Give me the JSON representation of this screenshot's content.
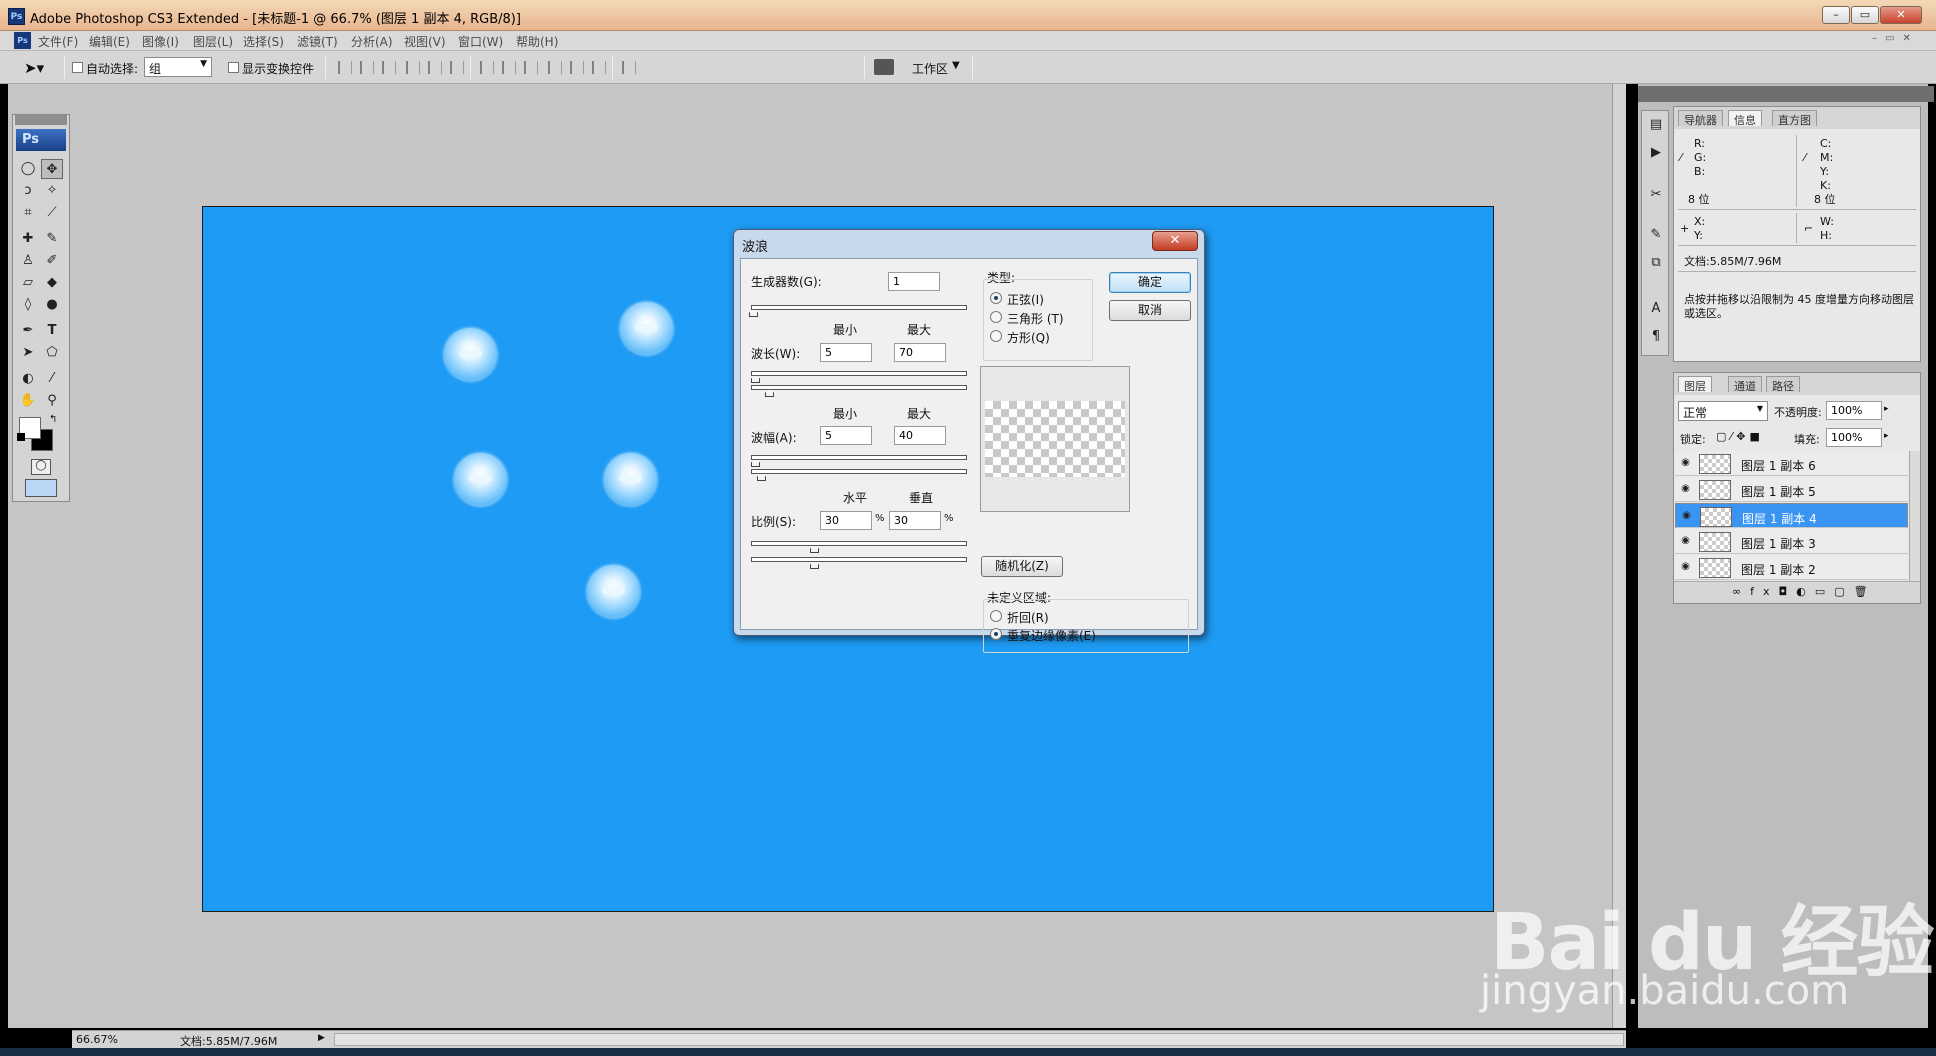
{
  "window": {
    "title": "Adobe Photoshop CS3 Extended - [未标题-1 @ 66.7% (图层 1 副本 4, RGB/8)]",
    "ps_logo": "Ps"
  },
  "menu": [
    "文件(F)",
    "编辑(E)",
    "图像(I)",
    "图层(L)",
    "选择(S)",
    "滤镜(T)",
    "分析(A)",
    "视图(V)",
    "窗口(W)",
    "帮助(H)"
  ],
  "options": {
    "auto_select_label": "自动选择:",
    "auto_select_value": "组",
    "show_transform_label": "显示变换控件",
    "workspace_label": "工作区"
  },
  "toolbox": {
    "logo": "Ps"
  },
  "dialog": {
    "title": "波浪",
    "generators_label": "生成器数(G):",
    "generators_value": "1",
    "min_label": "最小",
    "max_label": "最大",
    "wavelength_label": "波长(W):",
    "wavelength_min": "5",
    "wavelength_max": "70",
    "amplitude_label": "波幅(A):",
    "amplitude_min": "5",
    "amplitude_max": "40",
    "horizontal_label": "水平",
    "vertical_label": "垂直",
    "scale_label": "比例(S):",
    "scale_h": "30",
    "scale_v": "30",
    "percent": "%",
    "type_label": "类型:",
    "types": [
      "正弦(I)",
      "三角形 (T)",
      "方形(Q)"
    ],
    "ok": "确定",
    "cancel": "取消",
    "randomize": "随机化(Z)",
    "undefined_label": "未定义区域:",
    "undefined_opts": [
      "折回(R)",
      "重复边缘像素(E)"
    ]
  },
  "info_panel": {
    "tabs": [
      "导航器",
      "信息",
      "直方图"
    ],
    "r": "R:",
    "g": "G:",
    "b": "B:",
    "c": "C:",
    "m": "M:",
    "y": "Y:",
    "k": "K:",
    "bits_left": "8 位",
    "bits_right": "8 位",
    "x": "X:",
    "y2": "Y:",
    "w": "W:",
    "h": "H:",
    "doc": "文档:5.85M/7.96M",
    "hint": "点按并拖移以沿限制为 45 度增量方向移动图层或选区。"
  },
  "layers_panel": {
    "tabs": [
      "图层",
      "通道",
      "路径"
    ],
    "blend": "正常",
    "opacity_label": "不透明度:",
    "opacity": "100%",
    "lock_label": "锁定:",
    "fill_label": "填充:",
    "fill": "100%",
    "layers": [
      "图层 1 副本 6",
      "图层 1 副本 5",
      "图层 1 副本 4",
      "图层 1 副本 3",
      "图层 1 副本 2"
    ]
  },
  "status": {
    "zoom": "66.67%",
    "doc": "文档:5.85M/7.96M"
  },
  "watermark": {
    "brand": "Bai du 经验",
    "url": "jingyan.baidu.com"
  },
  "colors": {
    "canvas": "#1e9bf4",
    "selected_layer": "#3a94f2",
    "title_bar": "#e8b48d"
  }
}
